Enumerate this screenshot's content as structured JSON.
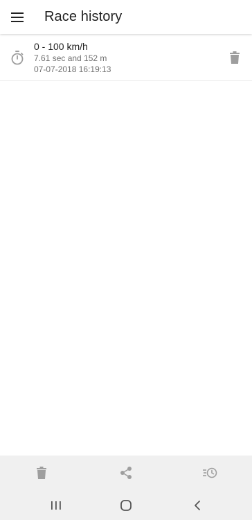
{
  "header": {
    "title": "Race history",
    "menu_icon": "hamburger-menu-icon"
  },
  "races": [
    {
      "title": "0 - 100 km/h",
      "detail": "7.61 sec and 152 m",
      "timestamp": "07-07-2018 16:19:13",
      "icon": "stopwatch-icon",
      "delete_icon": "trash-icon"
    }
  ],
  "bottom_actions": [
    {
      "icon": "trash-icon"
    },
    {
      "icon": "share-icon"
    },
    {
      "icon": "history-icon"
    }
  ],
  "system_nav": [
    {
      "icon": "recent-apps-icon"
    },
    {
      "icon": "home-icon"
    },
    {
      "icon": "back-icon"
    }
  ],
  "colors": {
    "icon_gray": "#9e9e9e",
    "bar_gray": "#f0f0f0",
    "nav_icon": "#555555"
  }
}
